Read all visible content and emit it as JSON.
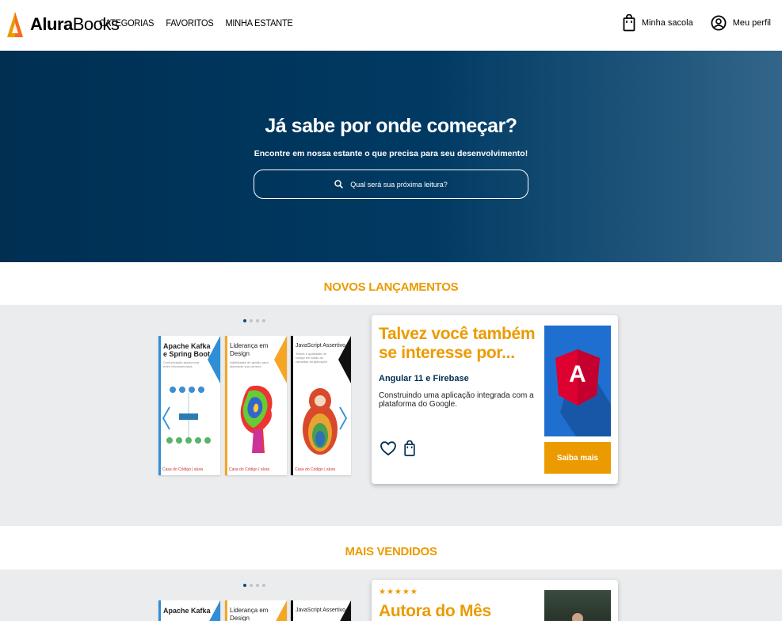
{
  "header": {
    "logo_bold": "Alura",
    "logo_rest": "Books",
    "nav": [
      "CATEGORIAS",
      "FAVORITOS",
      "MINHA ESTANTE"
    ],
    "bag_label": "Minha sacola",
    "profile_label": "Meu perfil",
    "accent_color": "#eb9b00",
    "brand_dark": "#002f52"
  },
  "hero": {
    "title": "Já sabe por onde começar?",
    "subtitle": "Encontre em nossa estante o que precisa para seu desenvolvimento!",
    "search_placeholder": "Qual será sua próxima leitura?"
  },
  "sections": [
    {
      "title": "NOVOS LANÇAMENTOS",
      "carousel_pages": 4,
      "carousel_active": 1,
      "books": [
        {
          "title_line1": "Apache Kafka",
          "title_line2": "e Spring Boot",
          "subtitle": "Comunicação assíncrona entre microsserviços",
          "accent": "#2f8fd6"
        },
        {
          "title_line1": "Liderança em",
          "title_line2": "Design",
          "subtitle": "Habilidades de gestão para alavancar sua carreira",
          "accent": "#f6a623"
        },
        {
          "title_line1": "JavaScript Assertivo",
          "title_line2": "",
          "subtitle": "Testes e qualidade de código em todas as camadas da aplicação",
          "accent": "#111111"
        }
      ],
      "card": {
        "heading": "Talvez você também se interesse por...",
        "book_title": "Angular 11 e Firebase",
        "description": "Construindo uma aplicação integrada com a plataforma do Google.",
        "button": "Saiba mais",
        "cover_letter": "A"
      }
    },
    {
      "title": "MAIS VENDIDOS",
      "carousel_pages": 4,
      "carousel_active": 1,
      "books": [
        {
          "title_line1": "Apache Kafka",
          "title_line2": "",
          "accent": "#2f8fd6"
        },
        {
          "title_line1": "Liderança em",
          "title_line2": "Design",
          "accent": "#f6a623"
        },
        {
          "title_line1": "JavaScript Assertivo",
          "title_line2": "",
          "accent": "#111111"
        }
      ],
      "card": {
        "stars": "★★★★★",
        "heading": "Autora do Mês"
      }
    }
  ],
  "book_footer": "Casa do Código | alura"
}
